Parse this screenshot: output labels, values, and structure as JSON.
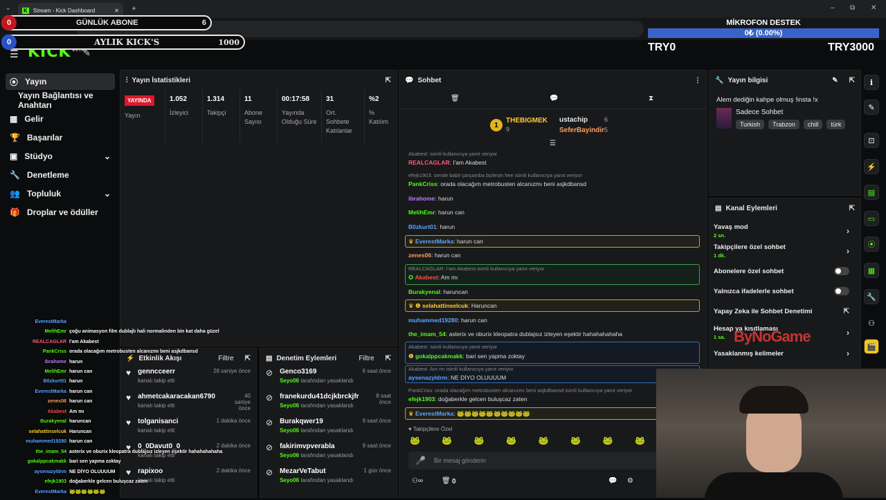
{
  "browser": {
    "tab_title": "Stream - Kick Dashboard",
    "url": "dashboard.kick.com/stream",
    "new_tab": "+",
    "win_min": "–",
    "win_max": "⧉",
    "win_close": "✕"
  },
  "overlay": {
    "daily_label": "GÜNLÜK ABONE",
    "daily_count": "0",
    "daily_value": "6",
    "monthly_label": "AYLIK KICK'S",
    "monthly_count": "0",
    "monthly_value": "1000",
    "mic_title": "MİKROFON DESTEK",
    "mic_value": "0₺ (0.00%)",
    "mic_progress": 0,
    "try_left": "TRY0",
    "try_right": "TRY3000",
    "watermark": "ByNoGame"
  },
  "kick": {
    "logo": "KICK",
    "logo_sub": "BETA"
  },
  "sidebar": {
    "items": [
      {
        "icon": "broadcast-icon",
        "label": "Yayın"
      },
      {
        "icon": "",
        "label": "Yayın Bağlantısı ve Anahtarı"
      },
      {
        "icon": "dollar-icon",
        "label": "Gelir"
      },
      {
        "icon": "trophy-icon",
        "label": "Başarılar"
      },
      {
        "icon": "studio-icon",
        "label": "Stüdyo"
      },
      {
        "icon": "wrench-icon",
        "label": "Denetleme"
      },
      {
        "icon": "community-icon",
        "label": "Topluluk"
      },
      {
        "icon": "gift-icon",
        "label": "Droplar ve ödüller"
      }
    ]
  },
  "stats": {
    "title": "Yayın İstatistikleri",
    "live_badge": "YAYINDA",
    "live_label": "Yayın",
    "items": [
      {
        "value": "1.052",
        "label": "İzleyici"
      },
      {
        "value": "1.314",
        "label": "Takipçi"
      },
      {
        "value": "11",
        "label": "Abone Sayısı"
      },
      {
        "value": "00:17:58",
        "label": "Yayında Olduğu Süre"
      },
      {
        "value": "31",
        "label": "Ort. Sohbete Katılanlar"
      },
      {
        "value": "%2",
        "label": "% Katılım"
      }
    ]
  },
  "activity": {
    "title": "Etkinlik Akışı",
    "filter": "Filtre",
    "items": [
      {
        "name": "genncceerr",
        "sub": "kanalı takip etti",
        "time": "28 saniye önce"
      },
      {
        "name": "ahmetcakaracakan6790",
        "sub": "kanalı takip etti",
        "time": "40 saniye önce"
      },
      {
        "name": "tolganisanci",
        "sub": "kanalı takip etti",
        "time": "1 dakika önce"
      },
      {
        "name": "0_0Davut0_0",
        "sub": "kanalı takip etti",
        "time": "2 dakika önce"
      },
      {
        "name": "rapixoo",
        "sub": "kanalı takip etti",
        "time": "2 dakika önce"
      }
    ]
  },
  "moderation": {
    "title": "Denetim Eylemleri",
    "filter": "Filtre",
    "items": [
      {
        "name": "Genco3169",
        "mod": "Seyo06",
        "sub": " tarafından yasaklandı",
        "time": "6 saat önce"
      },
      {
        "name": "franekurdu41dcjkbrckjfr",
        "mod": "Seyo06",
        "sub": " tarafından yasaklandı",
        "time": "8 saat önce"
      },
      {
        "name": "Burakqwer19",
        "mod": "Seyo06",
        "sub": " tarafından yasaklandı",
        "time": "9 saat önce"
      },
      {
        "name": "fakirimvpverabla",
        "mod": "Seyo06",
        "sub": " tarafından yasaklandı",
        "time": "9 saat önce"
      },
      {
        "name": "MezarVeTabut",
        "mod": "Seyo06",
        "sub": " tarafından yasaklandı",
        "time": "1 gün önce"
      }
    ]
  },
  "chat": {
    "title": "Sohbet",
    "top1": {
      "name": "THEBIGMEK",
      "count": "9",
      "rank": "1"
    },
    "top2": {
      "name": "ustachip",
      "count": "6"
    },
    "top3": {
      "name": "SeferBayindir",
      "count": "5"
    },
    "messages": [
      {
        "reply": "Akabest:       isimli kullanıcıya yanıt veriyor",
        "user": "REALCAGLAR",
        "color": "#ff5c7a",
        "text": ": I'am Akabest"
      },
      {
        "reply": "efejk1903: sende babil çarşamba bizlesin hee isimli kullanıcıya yanıt veriyor",
        "user": "PankCriss",
        "color": "#53fc18",
        "text": ": orada olacağım metrobusten alcanızmı beni asjkdbansd"
      },
      {
        "user": "ibrahome",
        "color": "#c07cff",
        "text": ": harun"
      },
      {
        "user": "MelihEmr",
        "color": "#53fc18",
        "text": ": harun can"
      },
      {
        "user": "B0zkurt01",
        "color": "#5aa6ff",
        "text": ": harun"
      },
      {
        "user": "EverestMarka",
        "color": "#5aa6ff",
        "text": ": harun can"
      },
      {
        "user": "zenes06",
        "color": "#ff9d5c",
        "text": ": harun can"
      },
      {
        "reply": "REALCAGLAR: I'am Akabest isimli kullanıcıya yanıt veriyor",
        "user": "Akabest",
        "color": "#ff4d4d",
        "text": ": Am mı"
      },
      {
        "user": "Burakyenal",
        "color": "#53fc18",
        "text": ": haruncan"
      },
      {
        "user": "selahattinselcuk",
        "color": "#ffcc33",
        "text": ": Haruncan"
      },
      {
        "user": "muhammed19280",
        "color": "#5aa6ff",
        "text": ": harun can"
      },
      {
        "user": "the_imam_54",
        "color": "#53fc18",
        "text": ": asterix ve oburix kleopatra dublajsız izleyen eşektir hahahahahaha"
      },
      {
        "reply": "Akabest:       isimli kullanıcıya yanıt veriyor",
        "user": "gokalppcakmakk",
        "color": "#53fc18",
        "text": ": bari sen yapma zoktay"
      },
      {
        "reply": "Akabest: Am mı isimli kullanıcıya yanıt veriyor",
        "user": "aysenazyldrm",
        "color": "#5aa6ff",
        "text": ": NE DİYO OLUUUUM"
      },
      {
        "reply": "PankCriss: orada olacağım metrobusten alcanızmı beni asjkdbansd isimli kullanıcıya yanıt veriyor",
        "user": "efejk1903",
        "color": "#53fc18",
        "text": ": doğaberkle gelcen buluşcaz zaten"
      },
      {
        "user": "EverestMarka",
        "color": "#5aa6ff",
        "text": ": 🐸🐸🐸🐸🐸🐸🐸🐸🐸🐸"
      }
    ],
    "followers_only": "Takipçilere Özel",
    "input_placeholder": "Bir mesaj gönderin",
    "bottom_count": "0"
  },
  "stream_info": {
    "title": "Yayın bilgisi",
    "stream_title": "Alem dediğin kahpe olmuş !insta !x",
    "category": "Sadece Sohbet",
    "tags": [
      "Turkish",
      "Trabzon",
      "chill",
      "türk"
    ]
  },
  "channel_actions": {
    "title": "Kanal Eylemleri",
    "items": [
      {
        "label": "Yavaş mod",
        "sub": "2 sn.",
        "control": "chevron"
      },
      {
        "label": "Takipçilere özel sohbet",
        "sub": "1 dk.",
        "control": "chevron"
      },
      {
        "label": "Abonelere özel sohbet",
        "sub": "",
        "control": "toggle"
      },
      {
        "label": "Yalnızca ifadelerle sohbet",
        "sub": "",
        "control": "toggle"
      },
      {
        "label": "Yapay Zeka ile Sohbet Denetimi",
        "sub": "",
        "control": "external"
      },
      {
        "label": "Hesap ya    kısıtlaması",
        "sub": "1 sa.",
        "control": "chevron"
      },
      {
        "label": "Yasaklanmış kelimeler",
        "sub": "",
        "control": "chevron"
      }
    ]
  },
  "overlay_chat": [
    {
      "name": "EverestMarka",
      "color": "#5aa6ff",
      "text": ""
    },
    {
      "name": "MelihEmr",
      "color": "#53fc18",
      "text": "çoğu animasyon film dublajlı hali normalinden bin kat daha güzel"
    },
    {
      "name": "REALCAGLAR",
      "color": "#ff5c7a",
      "text": "I'am Akabest"
    },
    {
      "name": "PankCriss",
      "color": "#53fc18",
      "text": "orada olacağım metrobusten alcanızmı beni asjkdbansd"
    },
    {
      "name": "ibrahome",
      "color": "#c07cff",
      "text": "harun"
    },
    {
      "name": "MelihEmr",
      "color": "#53fc18",
      "text": "harun can"
    },
    {
      "name": "B0zkurt01",
      "color": "#5aa6ff",
      "text": "harun"
    },
    {
      "name": "EverestMarka",
      "color": "#5aa6ff",
      "text": "harun can"
    },
    {
      "name": "zenes06",
      "color": "#ff9d5c",
      "text": "harun can"
    },
    {
      "name": "Akabest",
      "color": "#ff4d4d",
      "text": "Am mı"
    },
    {
      "name": "Burakyenal",
      "color": "#53fc18",
      "text": "haruncan"
    },
    {
      "name": "selahattinselcuk",
      "color": "#ffcc33",
      "text": "Haruncan"
    },
    {
      "name": "muhammed19280",
      "color": "#5aa6ff",
      "text": "harun can"
    },
    {
      "name": "the_imam_54",
      "color": "#53fc18",
      "text": "asterix ve oburix kleopatra dublajsız izleyen eşektir hahahahahaha"
    },
    {
      "name": "gokalppcakmakk",
      "color": "#53fc18",
      "text": "bari sen yapma zoktay"
    },
    {
      "name": "aysenazyldrm",
      "color": "#5aa6ff",
      "text": "NE DİYO OLUUUUM"
    },
    {
      "name": "efejk1903",
      "color": "#53fc18",
      "text": "doğaberkle gelcen buluşcaz zaten"
    },
    {
      "name": "EverestMarka",
      "color": "#5aa6ff",
      "text": "🐸🐸🐸🐸🐸🐸"
    }
  ],
  "colors": {
    "accent": "#53fc18",
    "bg": "#0b0c0d",
    "panel": "#18191b",
    "live": "#e0162b"
  }
}
